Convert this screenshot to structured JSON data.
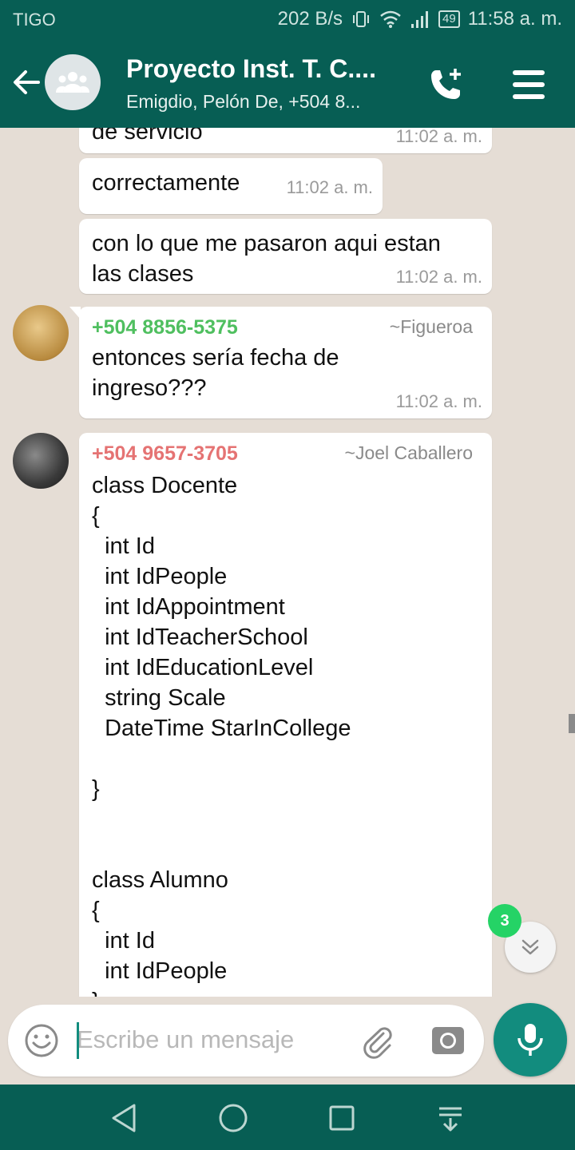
{
  "status_bar": {
    "carrier": "TIGO",
    "speed": "202 B/s",
    "battery": "49",
    "time": "11:58 a. m."
  },
  "header": {
    "title": "Proyecto Inst. T. C....",
    "subtitle": "Emigdio, Pelón De, +504 8..."
  },
  "messages": [
    {
      "text": "de servicio",
      "time": "11:02 a. m."
    },
    {
      "text": "correctamente",
      "time": "11:02 a. m."
    },
    {
      "text": "con lo que me pasaron aqui estan\nlas clases",
      "time": "11:02 a. m."
    },
    {
      "sender": "+504 8856-5375",
      "alias": "~Figueroa",
      "text": "entonces sería fecha de\ningreso???",
      "time": "11:02 a. m."
    },
    {
      "sender": "+504 9657-3705",
      "alias": "~Joel Caballero",
      "text": "class Docente\n{\n  int Id\n  int IdPeople\n  int IdAppointment\n  int IdTeacherSchool\n  int IdEducationLevel\n  string Scale\n  DateTime StarInCollege\n\n}\n\n\nclass Alumno\n{\n  int Id\n  int IdPeople\n}"
    }
  ],
  "unread_count": "3",
  "input": {
    "placeholder": "Escribe un mensaje",
    "value": ""
  },
  "colors": {
    "header": "#075e54",
    "accent": "#128c7e",
    "badge": "#25d366",
    "sender_1": "#4fbf5f",
    "sender_2": "#e57373",
    "chat_bg": "#e5ddd5"
  },
  "icons": {
    "back": "arrow-left-icon",
    "group": "group-avatar-icon",
    "call": "add-call-icon",
    "menu": "menu-icon",
    "scroll": "chevron-double-down-icon",
    "emoji": "emoji-icon",
    "attach": "paperclip-icon",
    "camera": "camera-icon",
    "mic": "microphone-icon"
  }
}
